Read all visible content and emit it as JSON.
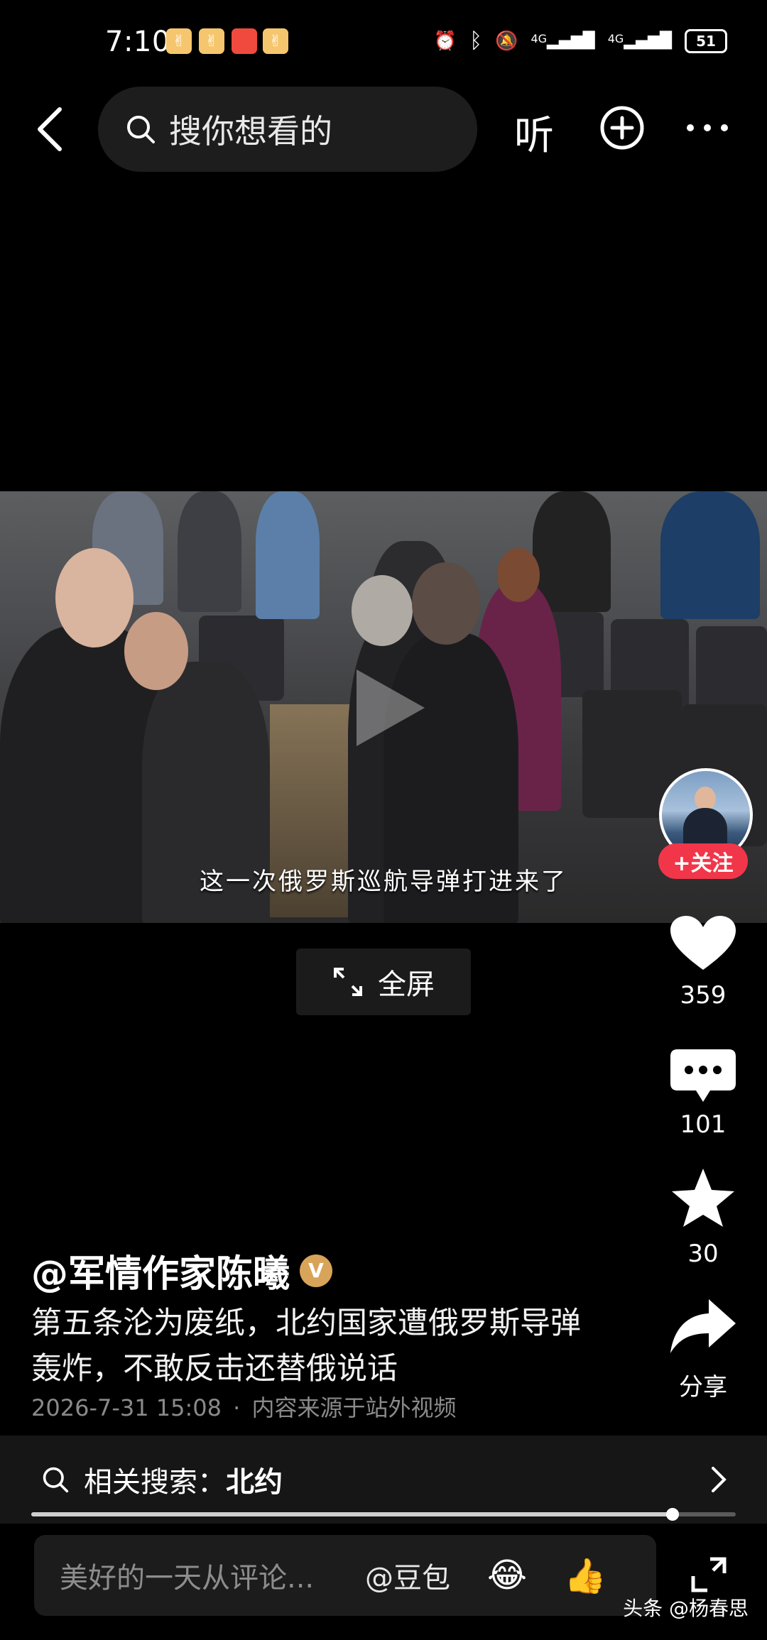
{
  "status_bar": {
    "time": "7:10",
    "battery": "51",
    "network_1": "4G",
    "network_2": "4G"
  },
  "nav": {
    "search_placeholder": "搜你想看的",
    "listen_label": "听"
  },
  "video": {
    "subtitle": "这一次俄罗斯巡航导弹打进来了",
    "fullscreen_label": "全屏"
  },
  "side": {
    "follow_label": "+关注",
    "likes": "359",
    "comments": "101",
    "favorites": "30",
    "share_label": "分享"
  },
  "info": {
    "author": "@军情作家陈曦",
    "verified_mark": "V",
    "title": "第五条沦为废纸，北约国家遭俄罗斯导弹轰炸，不敢反击还替俄说话",
    "date": "2026-7-31 15:08",
    "separator": "·",
    "source": "内容来源于站外视频"
  },
  "related": {
    "prefix": "相关搜索：",
    "keyword": "北约"
  },
  "progress": {
    "fraction": 0.91
  },
  "comment_bar": {
    "placeholder": "美好的一天从评论...",
    "mention": "@豆包"
  },
  "watermark": "头条 @杨春思",
  "colors": {
    "accent": "#f2364a",
    "verified": "#d8a45a",
    "background": "#000000"
  }
}
